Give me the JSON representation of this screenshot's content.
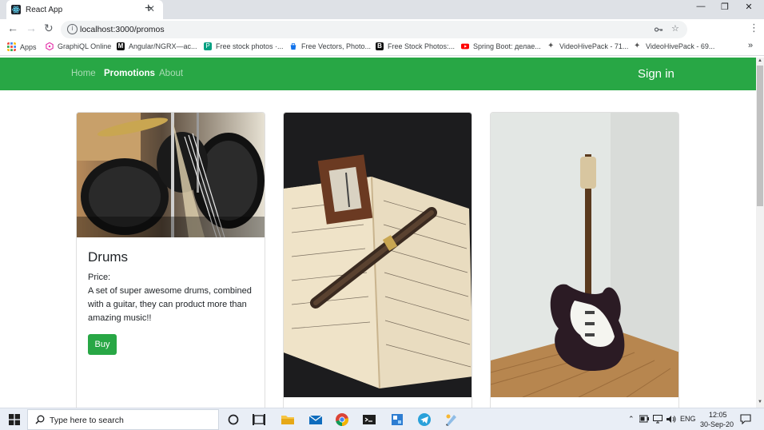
{
  "browser": {
    "tab_title": "React App",
    "tab_close": "✕",
    "new_tab": "+",
    "url": "localhost:3000/promos",
    "win_minimize": "—",
    "win_restore": "❐",
    "win_close": "✕"
  },
  "bookmarks": [
    {
      "label": "Apps",
      "color": "#ea4335"
    },
    {
      "label": "GraphiQL Online",
      "color": "#e535ab"
    },
    {
      "label": "Angular/NGRX—ас...",
      "color": "#111111"
    },
    {
      "label": "Free stock photos ·...",
      "color": "#05a081"
    },
    {
      "label": "Free Vectors, Photo...",
      "color": "#1273eb"
    },
    {
      "label": "Free Stock Photos:...",
      "color": "#111111"
    },
    {
      "label": "Spring Boot: делае...",
      "color": "#ff0000"
    },
    {
      "label": "VideoHivePack - 71...",
      "color": "#555555"
    },
    {
      "label": "VideoHivePack - 69...",
      "color": "#555555"
    },
    {
      "label": "»",
      "color": ""
    }
  ],
  "appnav": {
    "links": [
      {
        "label": "Home",
        "active": false
      },
      {
        "label": "Promotions",
        "active": true
      },
      {
        "label": "About",
        "active": false
      }
    ],
    "signin": "Sign in",
    "bg": "#28a745"
  },
  "cards": [
    {
      "title": "Drums",
      "price_label": "Price:",
      "description": "A set of super awesome drums, combined with a guitar, they can product more than amazing music!!",
      "button": "Buy"
    },
    {
      "title": "",
      "price_label": "",
      "description": "",
      "button": ""
    },
    {
      "title": "",
      "price_label": "",
      "description": "",
      "button": ""
    }
  ],
  "taskbar": {
    "search_placeholder": "Type here to search",
    "lang": "ENG",
    "time": "12:05",
    "date": "30-Sep-20"
  }
}
